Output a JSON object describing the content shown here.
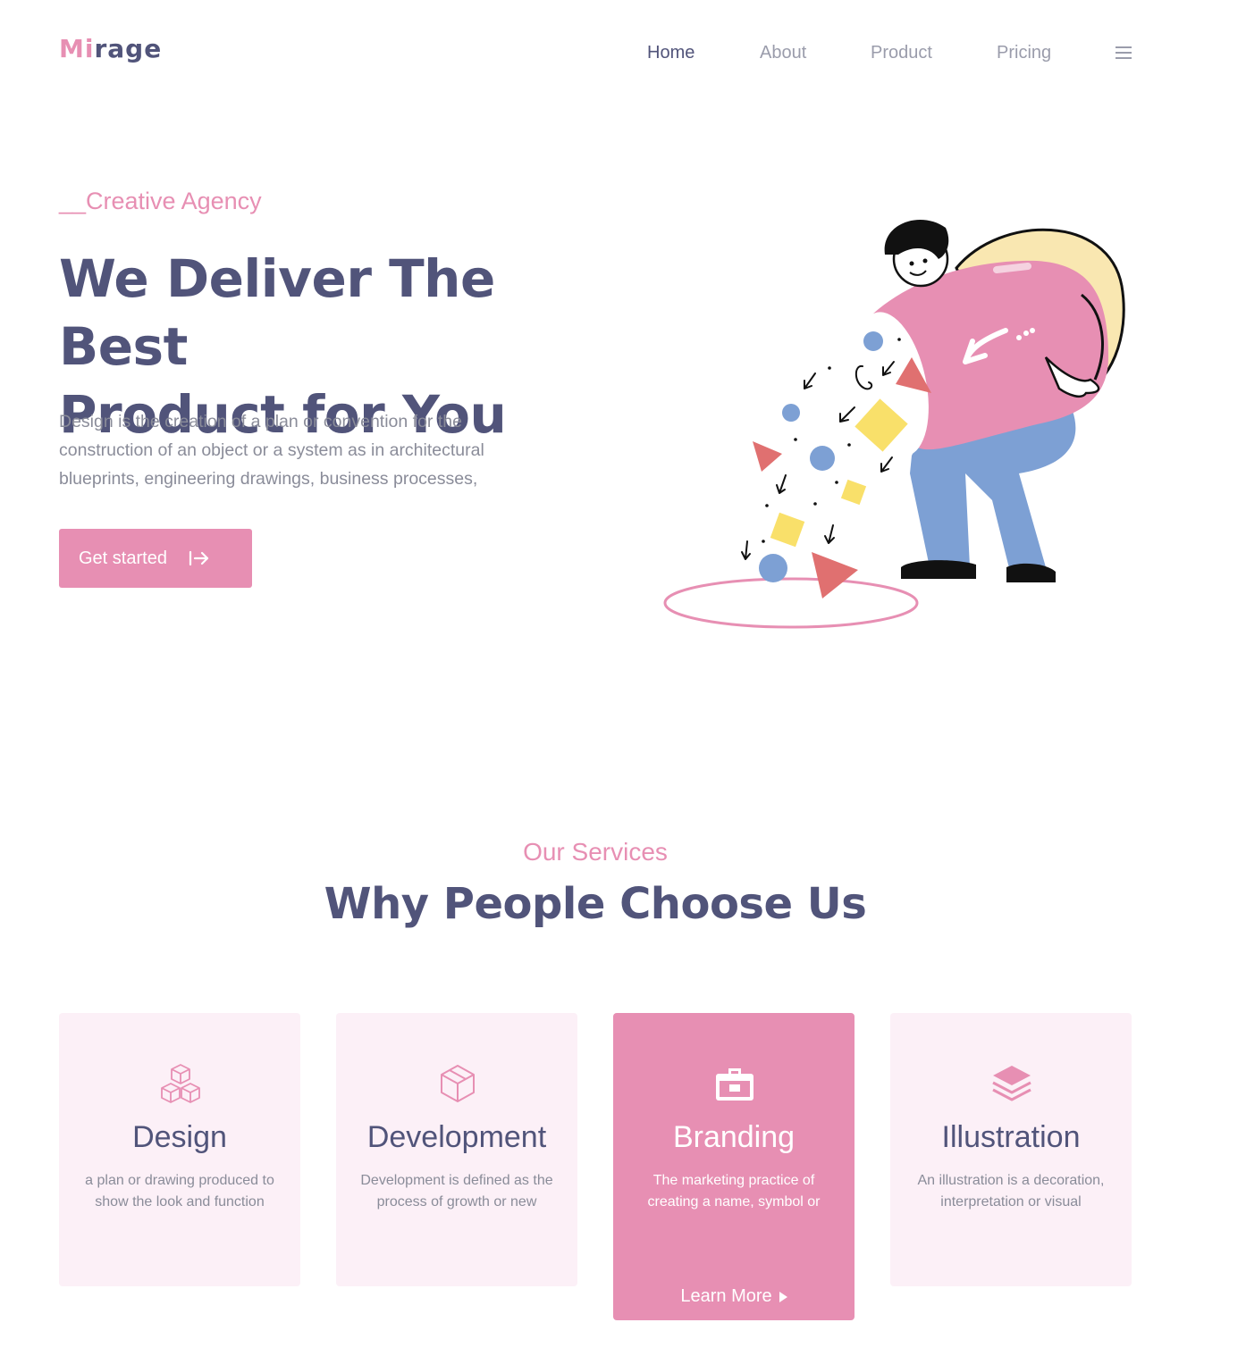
{
  "brand": {
    "logo_part1": "Mi",
    "logo_part2": "rage"
  },
  "nav": {
    "items": [
      {
        "label": "Home",
        "active": true
      },
      {
        "label": "About",
        "active": false
      },
      {
        "label": "Product",
        "active": false
      },
      {
        "label": "Pricing",
        "active": false
      }
    ],
    "menu_icon": "hamburger-menu-icon"
  },
  "hero": {
    "eyebrow": "__Creative Agency",
    "title_line1": "We Deliver The Best",
    "title_line2": "Product for You",
    "description": "Design is the creation of a plan or convention for the construction of an object or a system as in architectural blueprints, engineering drawings, business processes,",
    "cta_label": "Get started",
    "cta_icon": "arrow-right-bar-icon"
  },
  "services": {
    "eyebrow": "Our Services",
    "title": "Why People Choose Us",
    "cards": [
      {
        "icon": "cubes-icon",
        "title": "Design",
        "description": "a plan or drawing produced to show the look and function",
        "featured": false
      },
      {
        "icon": "cube-icon",
        "title": "Development",
        "description": "Development is defined as the process of growth or new",
        "featured": false
      },
      {
        "icon": "briefcase-icon",
        "title": "Branding",
        "description": "The marketing practice of creating a name, symbol or",
        "featured": true,
        "link_label": "Learn More"
      },
      {
        "icon": "layers-icon",
        "title": "Illustration",
        "description": "An illustration is a decoration, interpretation or visual",
        "featured": false
      }
    ]
  },
  "colors": {
    "accent": "#e78fb3",
    "heading": "#51547a",
    "muted": "#8a8c99",
    "card_bg": "#fcf0f7",
    "nav_muted": "#9a9cab"
  }
}
